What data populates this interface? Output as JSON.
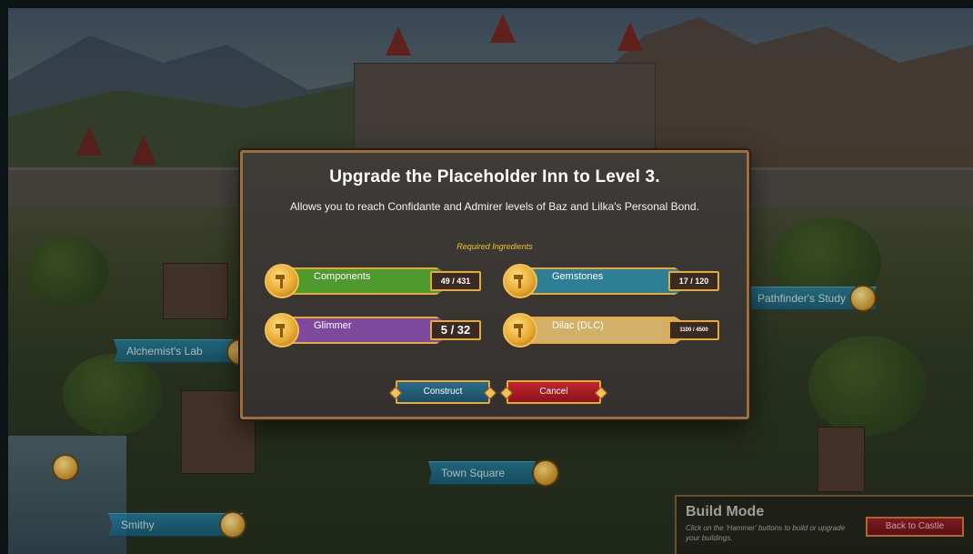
{
  "map_labels": {
    "alchemists_lab": "Alchemist's Lab",
    "pathfinders_study": "Pathfinder's Study",
    "town_square": "Town Square",
    "smithy": "Smithy"
  },
  "dialog": {
    "title": "Upgrade the Placeholder Inn to Level 3.",
    "description": "Allows you to reach Confidante and Admirer levels of Baz and Lilka's Personal Bond.",
    "required_label": "Required Ingredients",
    "ingredients": [
      {
        "name": "Components",
        "count": "49 / 431",
        "color": "#4e9a2f",
        "icon": "hammer-icon"
      },
      {
        "name": "Gemstones",
        "count": "17 / 120",
        "color": "#2c7f94",
        "icon": "hammer-icon"
      },
      {
        "name": "Glimmer",
        "count": "5 / 32",
        "color": "#7d4a9e",
        "icon": "hammer-icon"
      },
      {
        "name": "Dilac (DLC)",
        "count": "1100 / 4500",
        "color": "#d3b06a",
        "icon": "hammer-icon"
      }
    ],
    "construct_label": "Construct",
    "cancel_label": "Cancel"
  },
  "build_mode": {
    "title": "Build Mode",
    "hint": "Click on the 'Hammer' buttons to build or upgrade your buildings.",
    "back_label": "Back to Castle"
  }
}
